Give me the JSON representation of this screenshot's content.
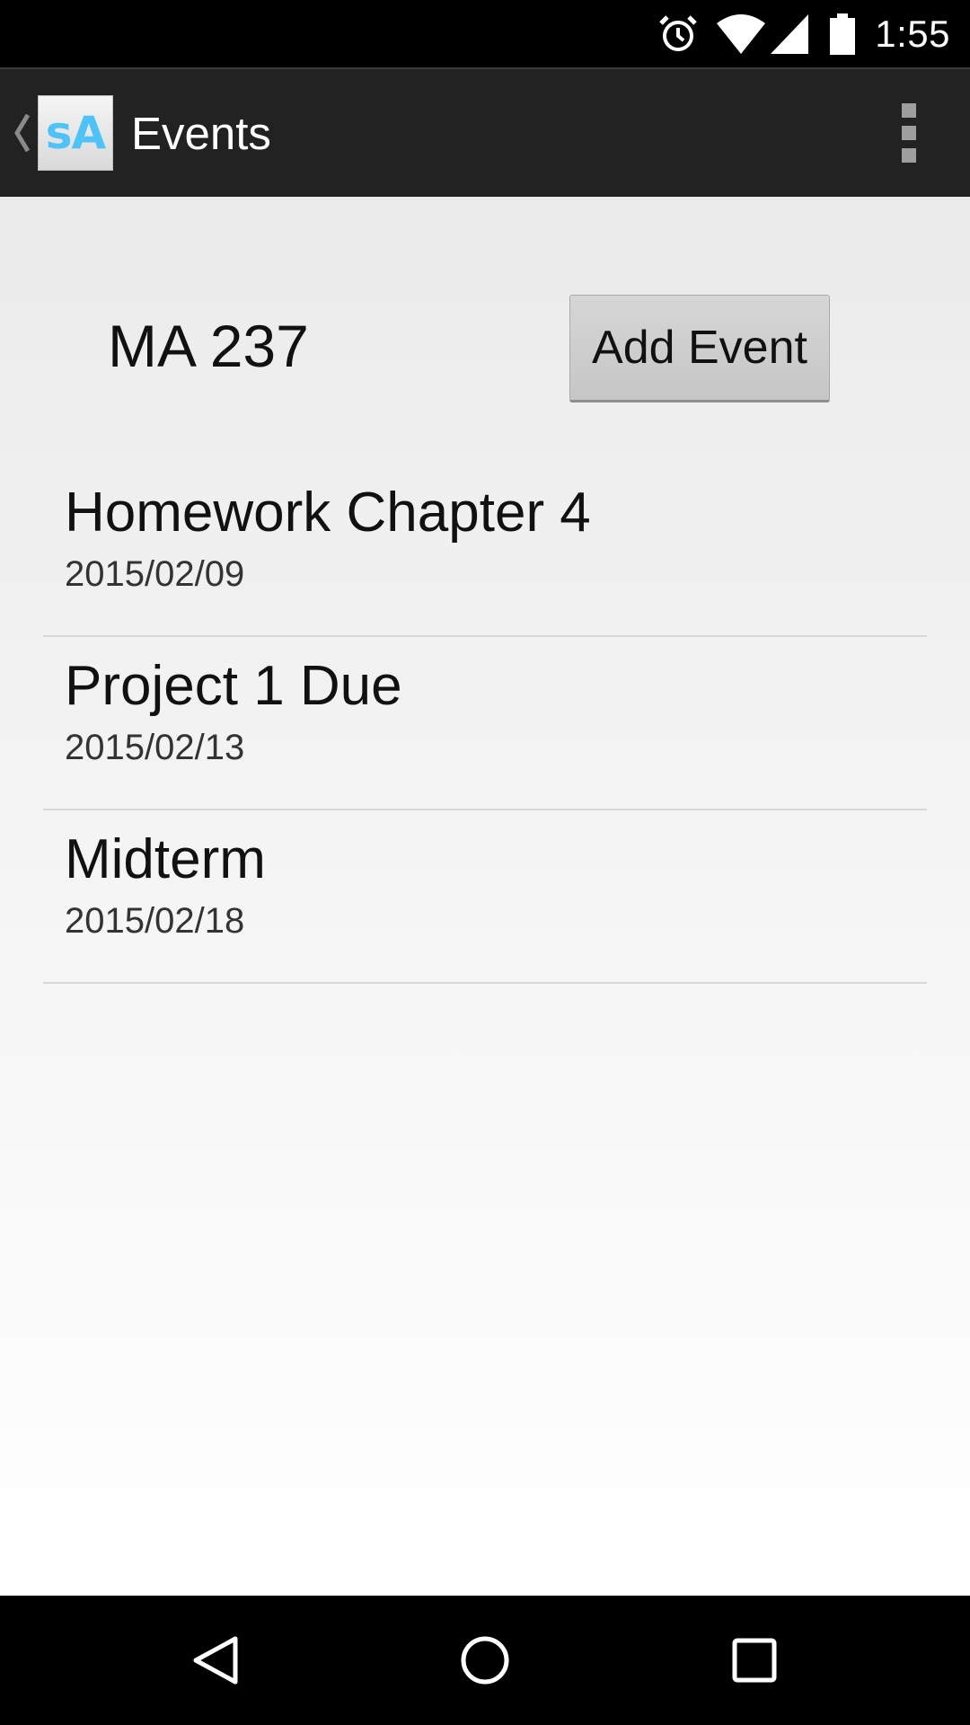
{
  "status_bar": {
    "time": "1:55",
    "icons": [
      "alarm-icon",
      "wifi-icon",
      "cell-signal-icon",
      "battery-icon"
    ]
  },
  "action_bar": {
    "logo_text": "sA",
    "title": "Events",
    "icons": [
      "back-caret-icon",
      "overflow-menu-icon"
    ]
  },
  "main": {
    "course_name": "MA 237",
    "add_button_label": "Add Event",
    "events": [
      {
        "title": "Homework Chapter 4",
        "date": "2015/02/09"
      },
      {
        "title": "Project 1 Due",
        "date": "2015/02/13"
      },
      {
        "title": "Midterm",
        "date": "2015/02/18"
      }
    ]
  },
  "nav_bar": {
    "icons": [
      "back-triangle-icon",
      "home-circle-icon",
      "recents-square-icon"
    ]
  },
  "colors": {
    "action_bar_bg": "#222222",
    "logo_accent": "#4fc3f7",
    "content_bg": "#ebebeb",
    "divider": "#d8d8d8"
  }
}
